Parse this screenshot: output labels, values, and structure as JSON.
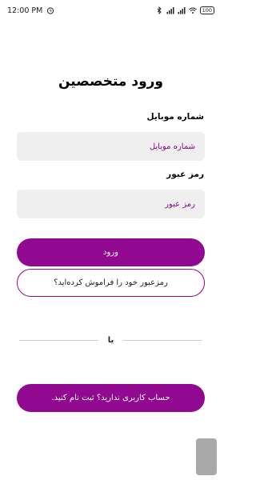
{
  "status_bar": {
    "time": "12:00 PM",
    "battery": "100"
  },
  "page": {
    "title": "ورود متخصصین"
  },
  "form": {
    "mobile": {
      "label": "شماره موبایل",
      "placeholder": "شماره موبایل"
    },
    "password": {
      "label": "رمز عبور",
      "placeholder": "رمز عبور"
    }
  },
  "buttons": {
    "login": "ورود",
    "forgot": "رمزعبور خود را فراموش کرده‌اید؟",
    "signup": "حساب کاربری ندارید؟ ثبت نام کنید."
  },
  "divider": {
    "text": "یا"
  },
  "colors": {
    "accent": "#910891",
    "input_bg": "#efefef",
    "input_text": "#8b0a8b"
  }
}
